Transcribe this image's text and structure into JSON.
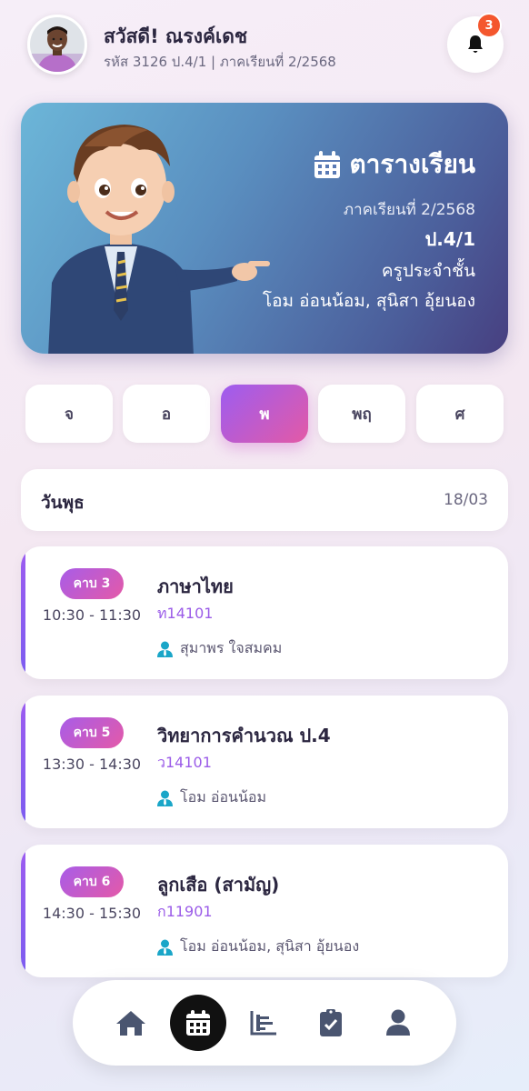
{
  "header": {
    "greeting": "สวัสดี! ณรงค์เดช",
    "student_info": "รหัส 3126 ป.4/1 | ภาคเรียนที่ 2/2568",
    "notification_count": "3"
  },
  "hero": {
    "title": "ตารางเรียน",
    "term": "ภาคเรียนที่ 2/2568",
    "class": "ป.4/1",
    "homeroom_label": "ครูประจำชั้น",
    "homeroom_teachers": "โอม อ่อนน้อม, สุนิสา อุ้ยนอง"
  },
  "days": [
    {
      "label": "จ",
      "active": false
    },
    {
      "label": "อ",
      "active": false
    },
    {
      "label": "พ",
      "active": true
    },
    {
      "label": "พฤ",
      "active": false
    },
    {
      "label": "ศ",
      "active": false
    }
  ],
  "day_header": {
    "day_name": "วันพุธ",
    "date": "18/03"
  },
  "classes": [
    {
      "period": "คาบ 3",
      "time": "10:30 - 11:30",
      "subject": "ภาษาไทย",
      "code": "ท14101",
      "teacher": "สุมาพร ใจสมคม"
    },
    {
      "period": "คาบ 5",
      "time": "13:30 - 14:30",
      "subject": "วิทยาการคำนวณ ป.4",
      "code": "ว14101",
      "teacher": "โอม อ่อนน้อม"
    },
    {
      "period": "คาบ 6",
      "time": "14:30 - 15:30",
      "subject": "ลูกเสือ (สามัญ)",
      "code": "ก11901",
      "teacher": "โอม อ่อนน้อม, สุนิสา อุ้ยนอง"
    }
  ],
  "nav": [
    {
      "icon": "home-icon",
      "active": false
    },
    {
      "icon": "calendar-icon",
      "active": true
    },
    {
      "icon": "chart-icon",
      "active": false
    },
    {
      "icon": "clipboard-check-icon",
      "active": false
    },
    {
      "icon": "user-icon",
      "active": false
    }
  ],
  "colors": {
    "accent_purple": "#9d5cf0",
    "accent_pink": "#e35aa6",
    "badge_red": "#f4572e",
    "teacher_icon": "#1aa6c8"
  }
}
